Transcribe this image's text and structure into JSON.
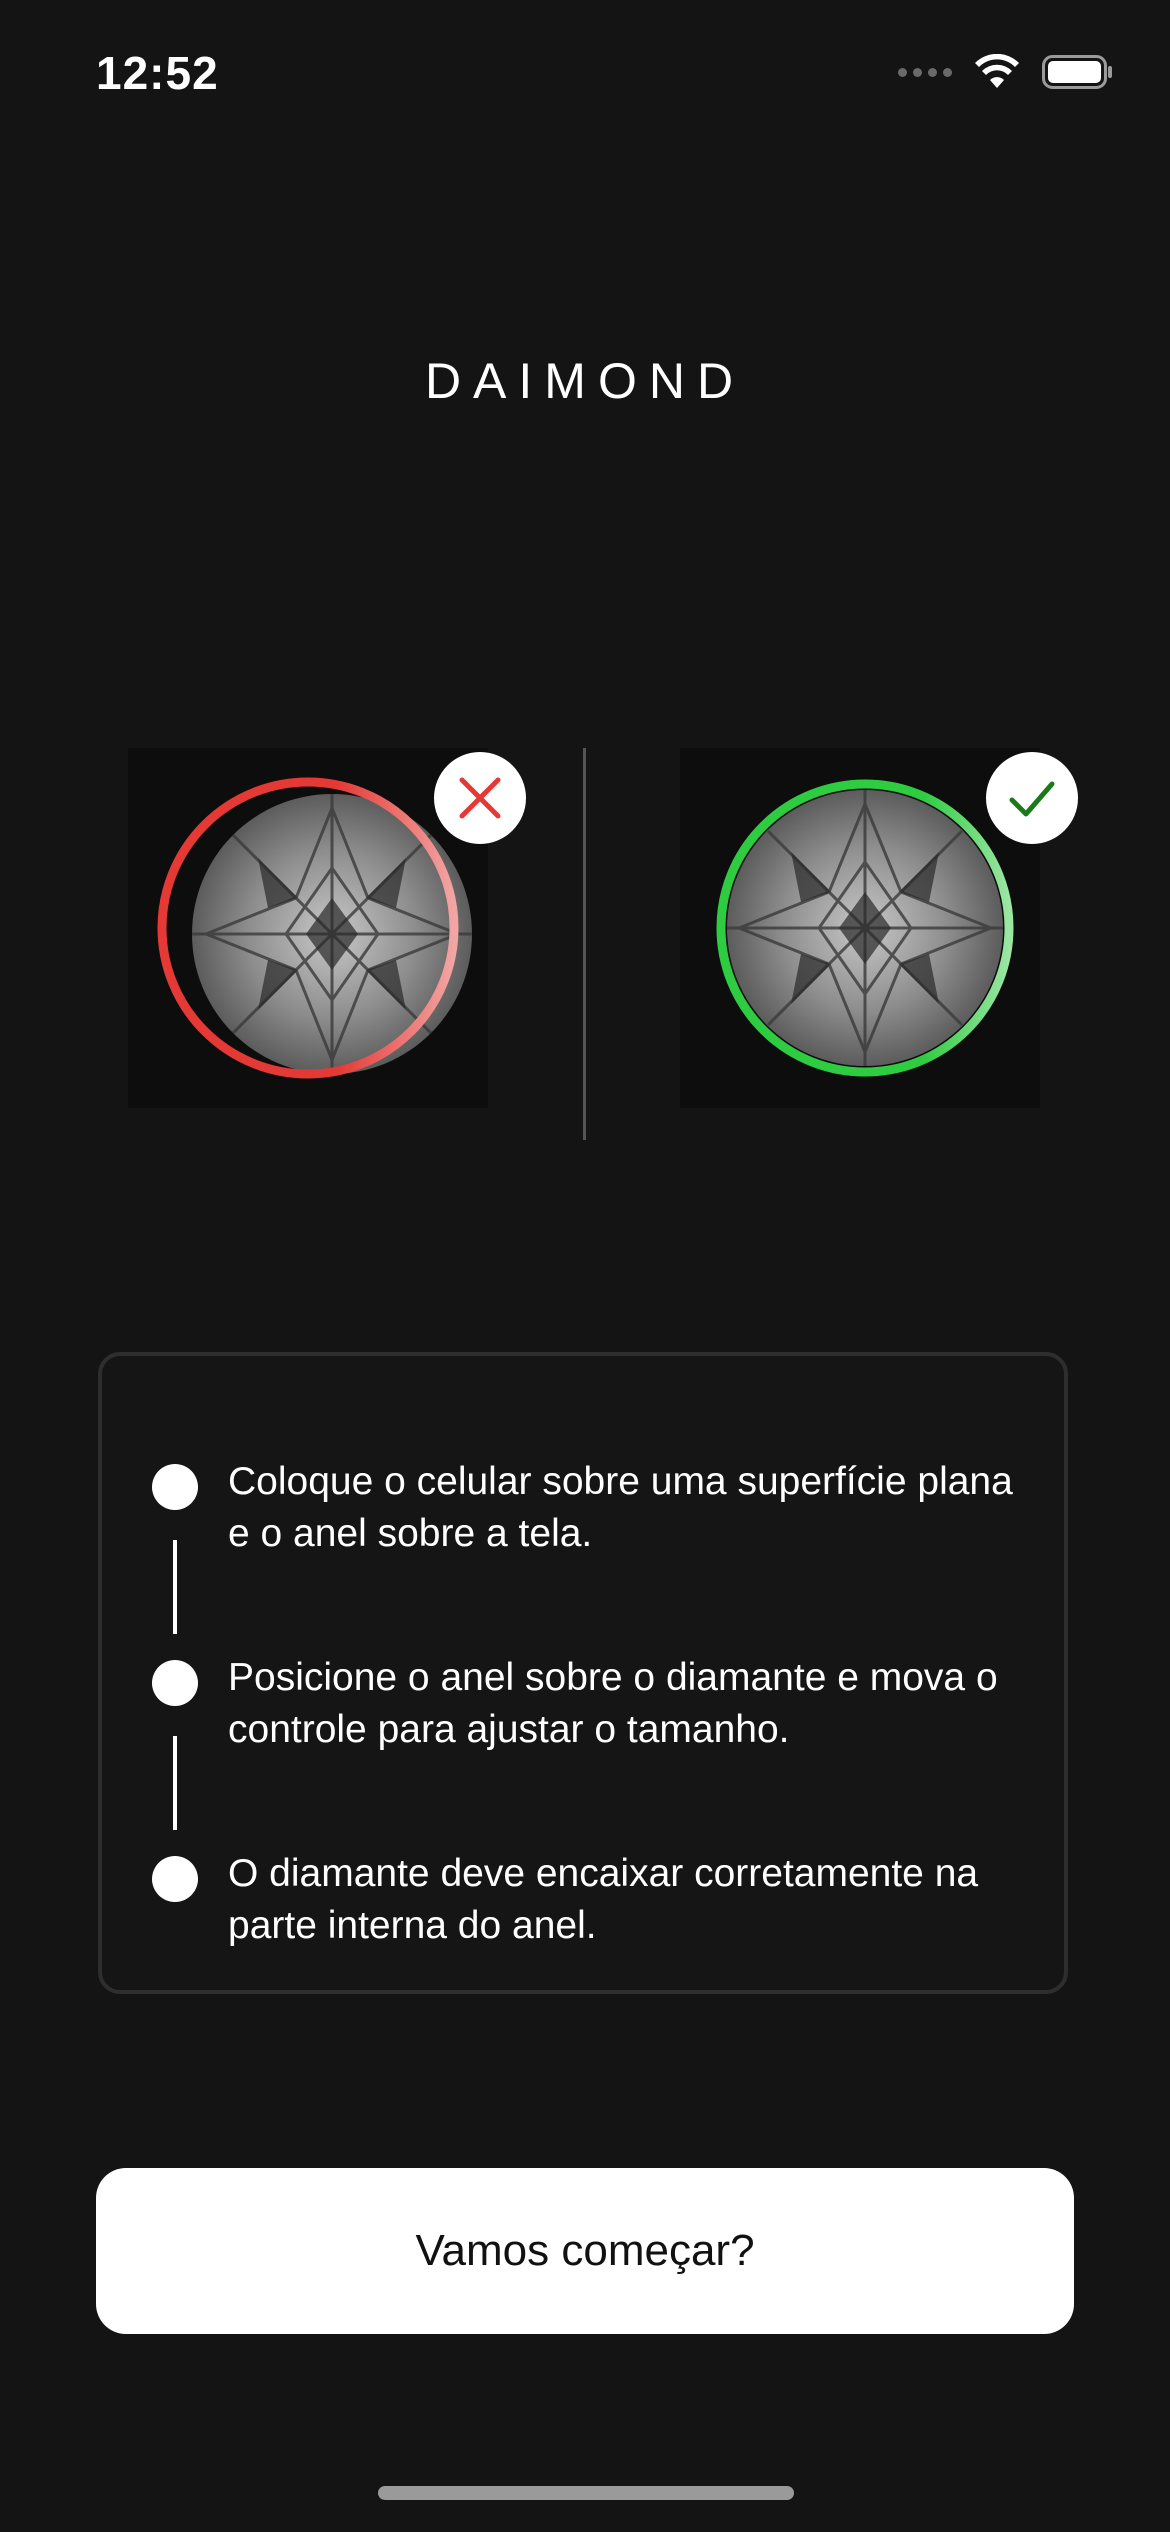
{
  "status_bar": {
    "time": "12:52",
    "icons": [
      "signal-dots-icon",
      "wifi-icon",
      "battery-icon"
    ]
  },
  "brand": {
    "logo_text": "DAIMOND"
  },
  "comparison": {
    "wrong": {
      "badge_icon": "close-icon",
      "ring_color": "#e53935",
      "badge_color": "#e53935"
    },
    "right": {
      "badge_icon": "check-icon",
      "ring_color": "#2ecc40",
      "badge_color": "#1a7a1a"
    }
  },
  "instructions": [
    {
      "text": "Coloque o celular sobre uma superfície plana e o anel sobre a tela."
    },
    {
      "text": "Posicione o anel sobre o diamante e mova o controle para ajustar o tamanho."
    },
    {
      "text": "O diamante deve encaixar corretamente na parte interna do anel."
    }
  ],
  "cta": {
    "label": "Vamos começar?"
  }
}
